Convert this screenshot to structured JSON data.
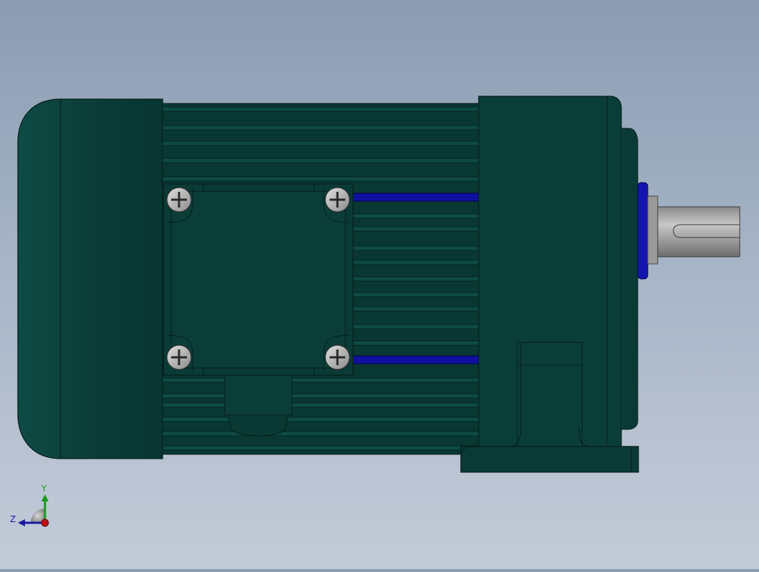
{
  "viewport": {
    "background_top": "#8b9cb2",
    "background_bottom": "#c3cbd8"
  },
  "model": {
    "body_color": "#0b3d38",
    "body_dark": "#062b27",
    "fin_color": "#0d4540",
    "accent_blue": "#1010a0",
    "shaft_color": "#a0a0a0",
    "screw_color": "#b8b8b8"
  },
  "triad": {
    "y_label": "Y",
    "z_label": "Z",
    "y_color": "#1a9a1a",
    "z_color": "#1a1aa0",
    "x_color": "#c01010"
  }
}
